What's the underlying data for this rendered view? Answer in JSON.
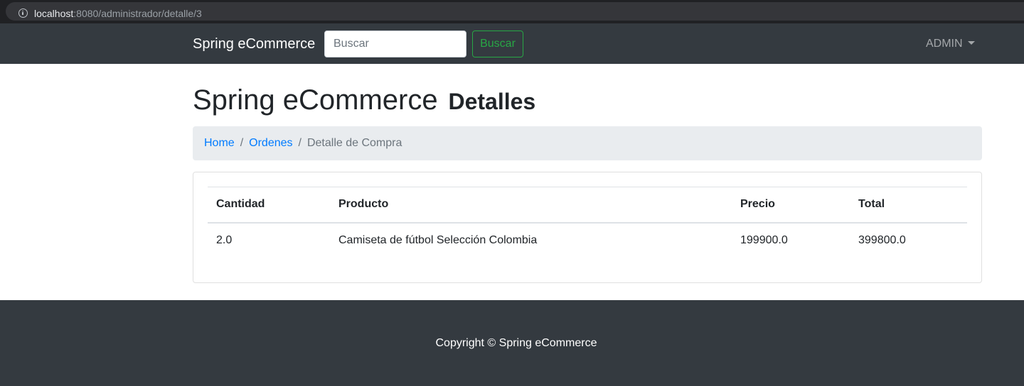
{
  "browser": {
    "url_host": "localhost",
    "url_rest": ":8080/administrador/detalle/3"
  },
  "navbar": {
    "brand": "Spring eCommerce",
    "search_placeholder": "Buscar",
    "search_button_label": "Buscar",
    "user_menu_label": "ADMIN"
  },
  "header": {
    "title": "Spring eCommerce",
    "subtitle": "Detalles"
  },
  "breadcrumb": {
    "items": [
      {
        "label": "Home"
      },
      {
        "label": "Ordenes"
      },
      {
        "label": "Detalle de Compra"
      }
    ],
    "separator": "/"
  },
  "table": {
    "columns": [
      "Cantidad",
      "Producto",
      "Precio",
      "Total"
    ],
    "rows": [
      [
        "2.0",
        "Camiseta de fútbol Selección Colombia",
        "199900.0",
        "399800.0"
      ]
    ]
  },
  "footer": {
    "copyright": "Copyright © Spring eCommerce"
  },
  "colors": {
    "navbar_bg": "#343a40",
    "link": "#007bff",
    "success": "#28a745",
    "breadcrumb_bg": "#e9ecef"
  }
}
